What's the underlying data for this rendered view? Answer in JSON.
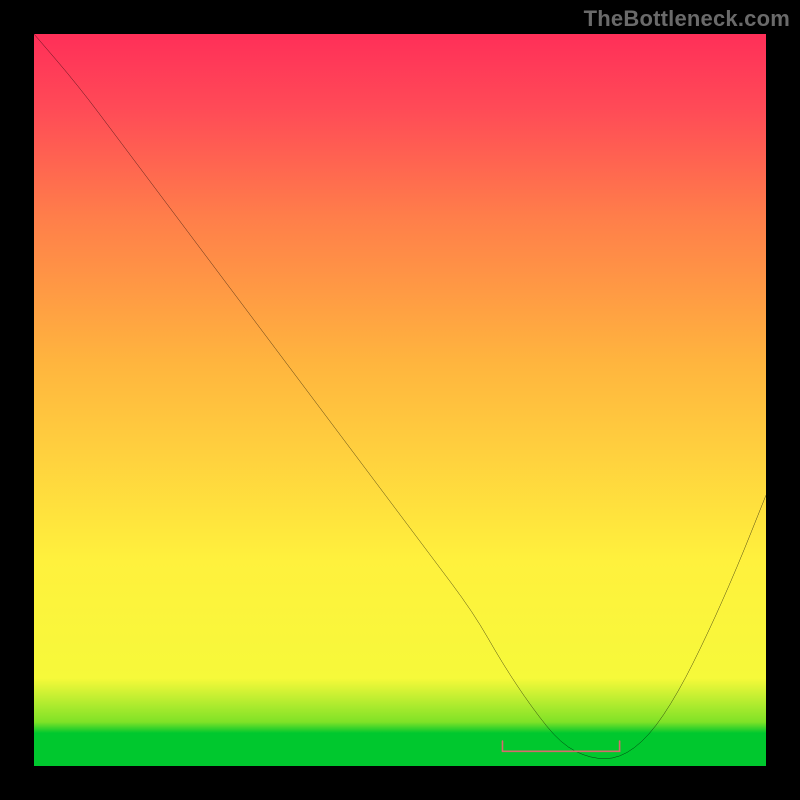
{
  "watermark": "TheBottleneck.com",
  "chart_data": {
    "type": "line",
    "title": "",
    "xlabel": "",
    "ylabel": "",
    "xlim": [
      0,
      100
    ],
    "ylim": [
      0,
      100
    ],
    "colors": {
      "background_black": "#000000",
      "gradient_top": "#ff2f58",
      "gradient_mid_upper": "#ff7e4a",
      "gradient_mid": "#ffb53e",
      "gradient_mid_lower": "#fff13d",
      "gradient_low": "#7fe227",
      "gradient_green": "#00c82e",
      "curve": "#000000",
      "marker": "#d86a6d"
    },
    "series": [
      {
        "name": "bottleneck-curve",
        "x": [
          0,
          6,
          12,
          18,
          24,
          30,
          36,
          42,
          48,
          54,
          60,
          64,
          68,
          72,
          76,
          80,
          84,
          88,
          92,
          96,
          100
        ],
        "y": [
          100,
          93,
          85,
          77,
          69,
          61,
          53,
          45,
          37,
          29,
          21,
          14,
          8,
          3,
          1,
          1,
          4,
          10,
          18,
          27,
          37
        ]
      }
    ],
    "marker_segment": {
      "name": "optimal-range",
      "x": [
        64,
        80
      ],
      "y": [
        2,
        2
      ]
    }
  }
}
